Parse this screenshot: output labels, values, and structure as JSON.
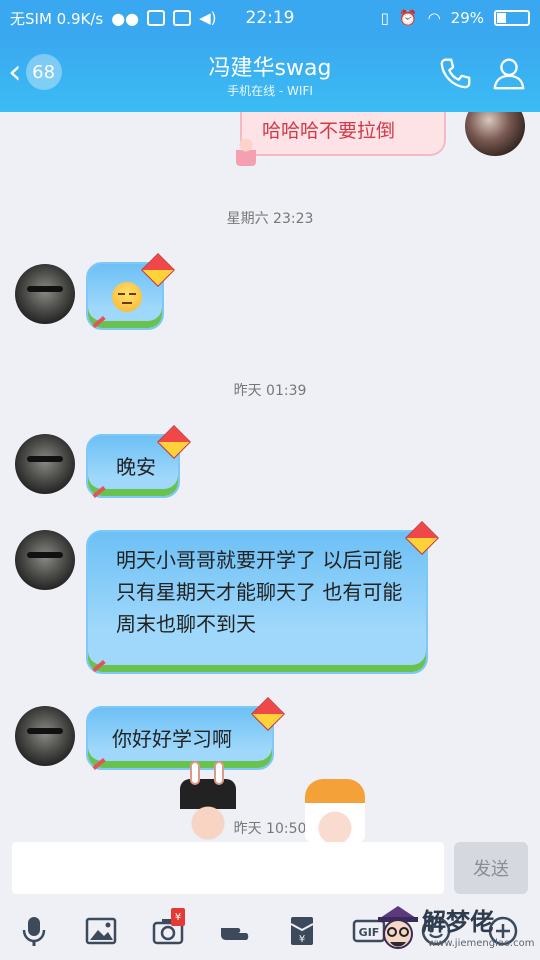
{
  "status_bar": {
    "carrier": "无SIM 0.9K/s",
    "time": "22:19",
    "battery_percent": "29%",
    "battery_level": 0.29
  },
  "header": {
    "unread_count": "68",
    "contact_name": "冯建华swag",
    "contact_status": "手机在线 - WIFI"
  },
  "messages": {
    "my_message": "哈哈哈不要拉倒",
    "ts1": "星期六 23:23",
    "ts2": "昨天 01:39",
    "msg_goodnight": "晚安",
    "msg_long": "明天小哥哥就要开学了  以后可能只有星期天才能聊天了  也有可能周末也聊不到天",
    "msg_study": "你好好学习啊",
    "ts3": "昨天 10:50"
  },
  "input": {
    "placeholder": "",
    "send_label": "发送"
  },
  "toolbar": {
    "redpacket_symbol": "¥",
    "gif_label": "GIF"
  },
  "watermark": {
    "text": "解梦佬",
    "url": "www.jiemenglao.com"
  },
  "colors": {
    "header_blue": "#3aa8f0",
    "bubble_blue": "#8ccff8",
    "grass_green": "#69c24d",
    "my_bubble_pink": "#fde3e6"
  }
}
